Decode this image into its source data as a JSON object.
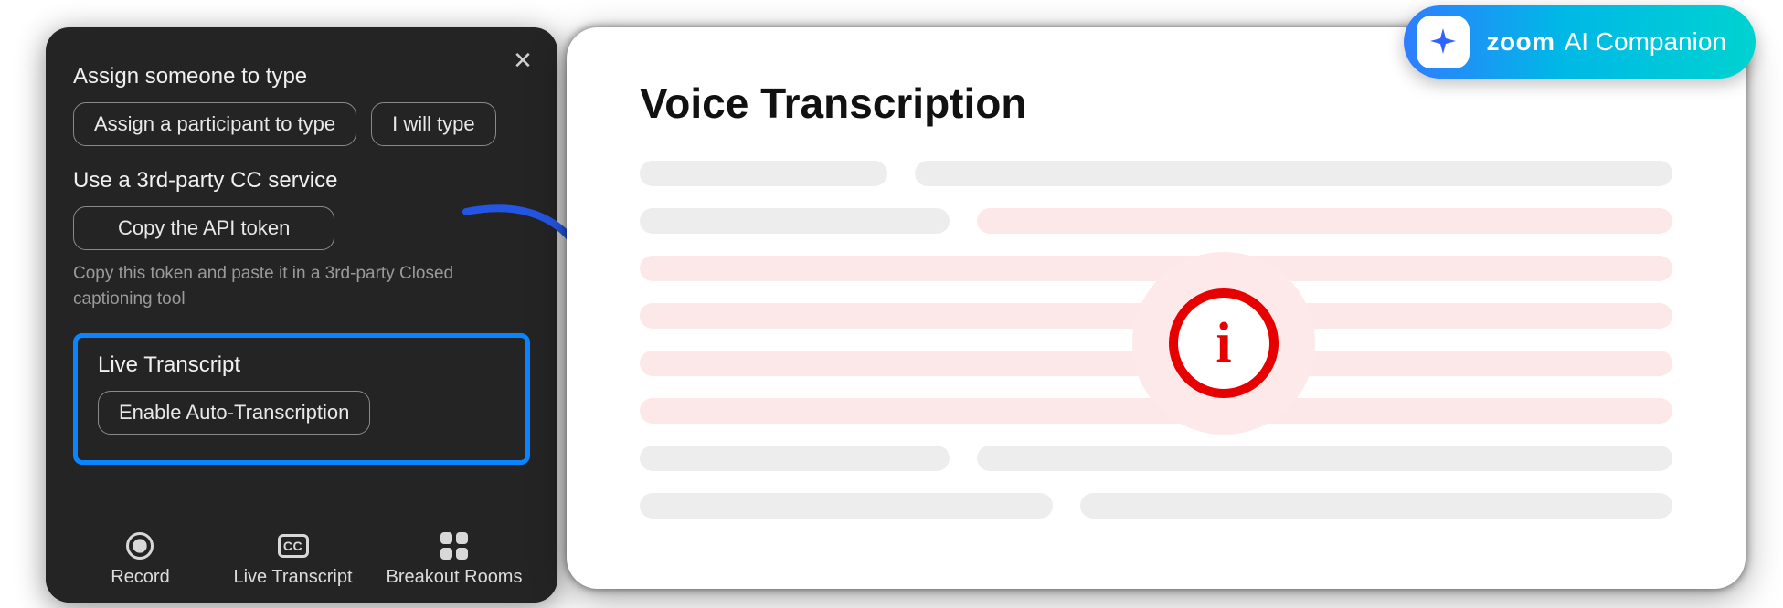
{
  "panel": {
    "assign_title": "Assign someone to type",
    "assign_btn": "Assign a participant to type",
    "self_btn": "I will type",
    "cc_title": "Use a 3rd-party CC service",
    "copy_btn": "Copy the API token",
    "copy_help": "Copy this token and paste it in a 3rd-party Closed captioning tool",
    "live_title": "Live Transcript",
    "enable_btn": "Enable Auto-Transcription",
    "toolbar": {
      "record": "Record",
      "transcript": "Live Transcript",
      "breakout": "Breakout Rooms",
      "cc_glyph": "CC"
    }
  },
  "card": {
    "title": "Voice Transcription",
    "info_char": "i"
  },
  "ai": {
    "brand": "zoom",
    "label": "AI Companion"
  }
}
